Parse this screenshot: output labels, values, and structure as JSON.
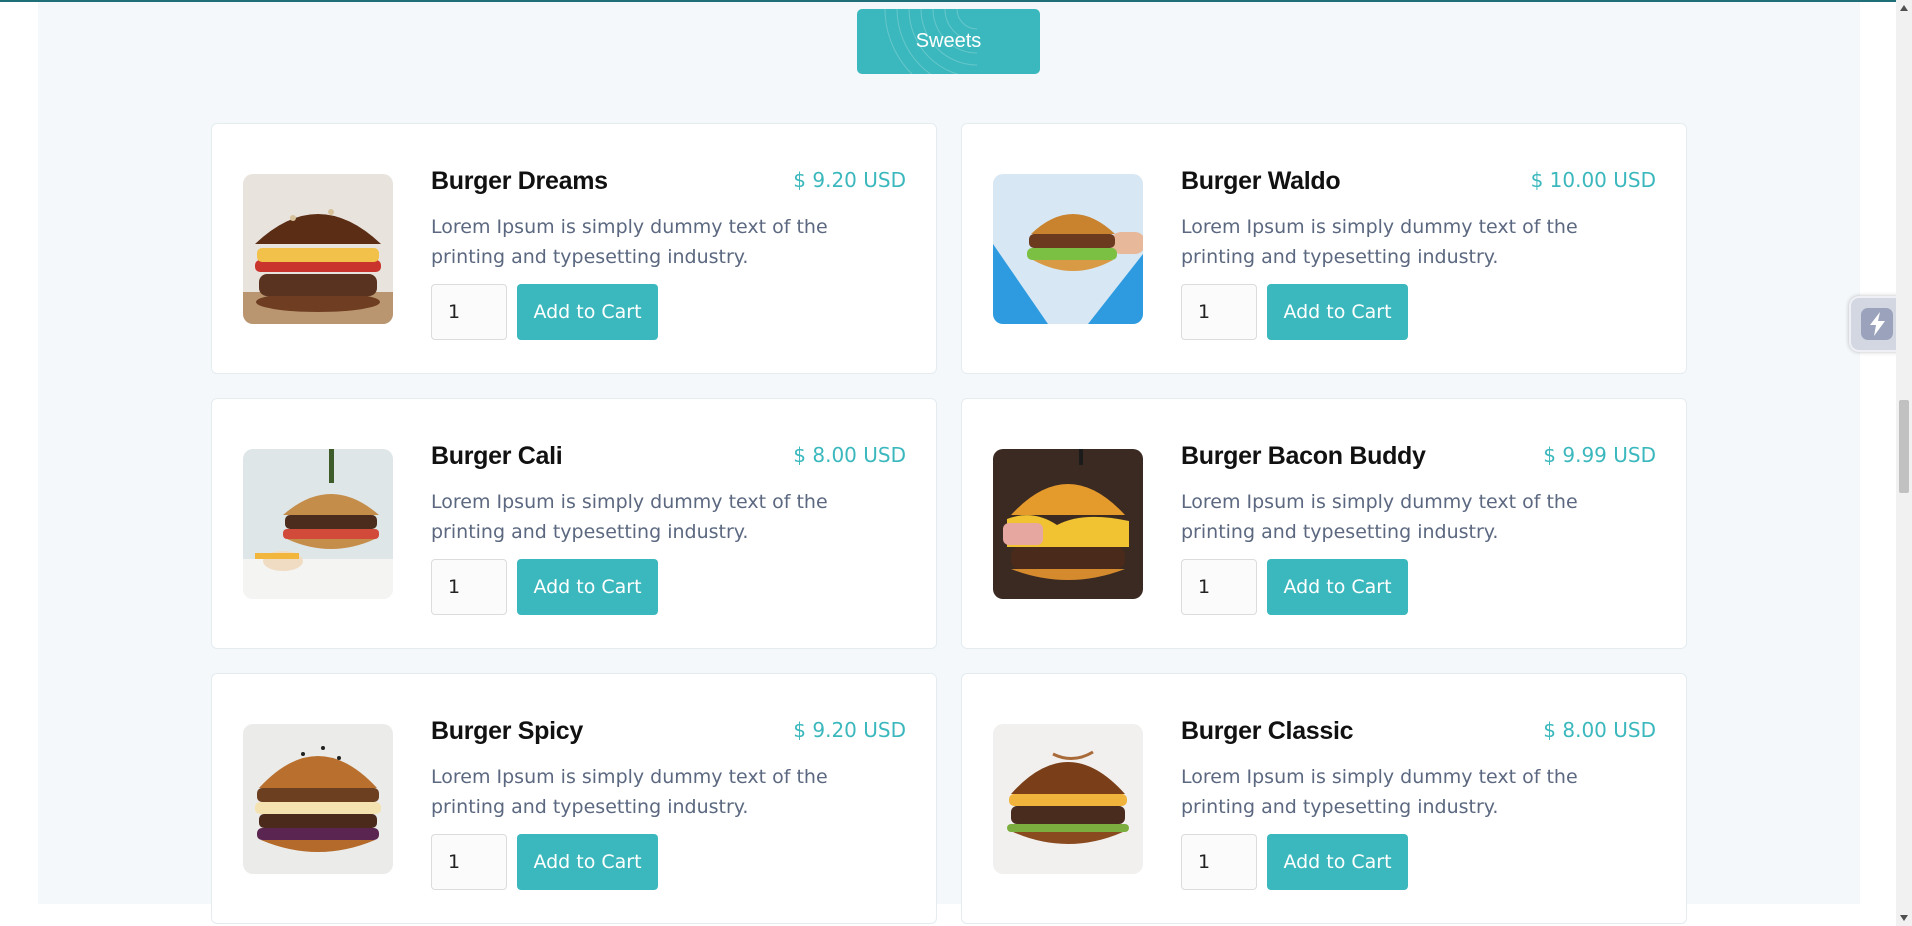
{
  "category_tab": {
    "label": "Sweets"
  },
  "colors": {
    "accent": "#3bb8bd",
    "page_background": "#f4f8fa",
    "description_text": "#5b6880",
    "top_line": "#1f6f78"
  },
  "products": [
    {
      "name": "Burger Dreams",
      "price": "$ 9.20 USD",
      "description": "Lorem Ipsum is simply dummy text of the printing and typesetting industry.",
      "quantity": "1",
      "button_label": "Add to Cart",
      "image": "burger-dreams-photo"
    },
    {
      "name": "Burger Waldo",
      "price": "$ 10.00 USD",
      "description": "Lorem Ipsum is simply dummy text of the printing and typesetting industry.",
      "quantity": "1",
      "button_label": "Add to Cart",
      "image": "burger-waldo-photo"
    },
    {
      "name": "Burger Cali",
      "price": "$ 8.00 USD",
      "description": "Lorem Ipsum is simply dummy text of the printing and typesetting industry.",
      "quantity": "1",
      "button_label": "Add to Cart",
      "image": "burger-cali-photo"
    },
    {
      "name": "Burger Bacon Buddy",
      "price": "$ 9.99 USD",
      "description": "Lorem Ipsum is simply dummy text of the printing and typesetting industry.",
      "quantity": "1",
      "button_label": "Add to Cart",
      "image": "burger-bacon-buddy-photo"
    },
    {
      "name": "Burger Spicy",
      "price": "$ 9.20 USD",
      "description": "Lorem Ipsum is simply dummy text of the printing and typesetting industry.",
      "quantity": "1",
      "button_label": "Add to Cart",
      "image": "burger-spicy-photo"
    },
    {
      "name": "Burger Classic",
      "price": "$ 8.00 USD",
      "description": "Lorem Ipsum is simply dummy text of the printing and typesetting industry.",
      "quantity": "1",
      "button_label": "Add to Cart",
      "image": "burger-classic-photo"
    }
  ],
  "floating_widget": {
    "icon": "lightning-bolt-icon"
  },
  "scrollbar": {
    "position": 0.45
  }
}
